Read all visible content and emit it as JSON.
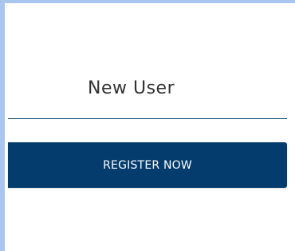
{
  "section": {
    "title": "New User"
  },
  "register": {
    "button_label": "REGISTER NOW"
  },
  "colors": {
    "accent": "#043c6d",
    "frame_border": "#a9c7ee"
  }
}
